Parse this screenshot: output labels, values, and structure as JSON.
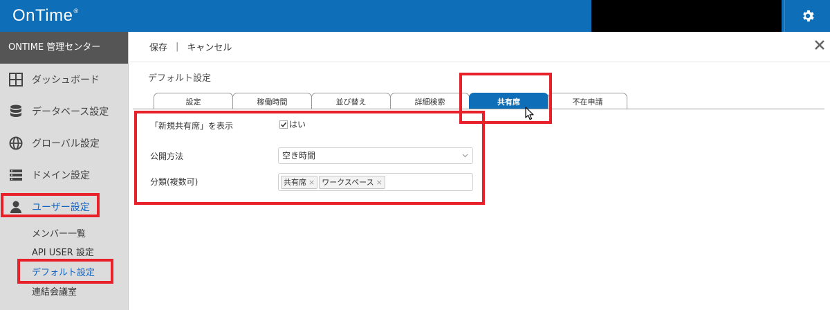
{
  "app": {
    "logo": "OnTime",
    "logo_mark": "®"
  },
  "sidebar": {
    "header": "ONTIME 管理センター",
    "items": [
      {
        "label": "ダッシュボード",
        "icon": "dashboard-icon"
      },
      {
        "label": "データベース設定",
        "icon": "database-icon"
      },
      {
        "label": "グローバル設定",
        "icon": "globe-icon"
      },
      {
        "label": "ドメイン設定",
        "icon": "server-icon"
      },
      {
        "label": "ユーザー設定",
        "icon": "user-icon"
      }
    ],
    "sub_items": [
      {
        "label": "メンバー一覧"
      },
      {
        "label": "API USER 設定"
      },
      {
        "label": "デフォルト設定"
      },
      {
        "label": "連結会議室"
      }
    ]
  },
  "actions": {
    "save": "保存",
    "separator": "|",
    "cancel": "キャンセル"
  },
  "section_title": "デフォルト設定",
  "tabs": [
    {
      "label": "設定"
    },
    {
      "label": "稼働時間"
    },
    {
      "label": "並び替え"
    },
    {
      "label": "詳細検索"
    },
    {
      "label": "共有席"
    },
    {
      "label": "不在申請"
    }
  ],
  "form": {
    "show_label": "「新規共有席」を表示",
    "show_checkbox_label": "はい",
    "show_checked": true,
    "publish_label": "公開方法",
    "publish_value": "空き時間",
    "category_label": "分類(複数可)",
    "category_chips": [
      "共有席",
      "ワークスペース"
    ],
    "chip_remove": "×"
  },
  "colors": {
    "brand": "#0e6fb8",
    "highlight": "#e8202a",
    "active_text": "#1565c0"
  }
}
